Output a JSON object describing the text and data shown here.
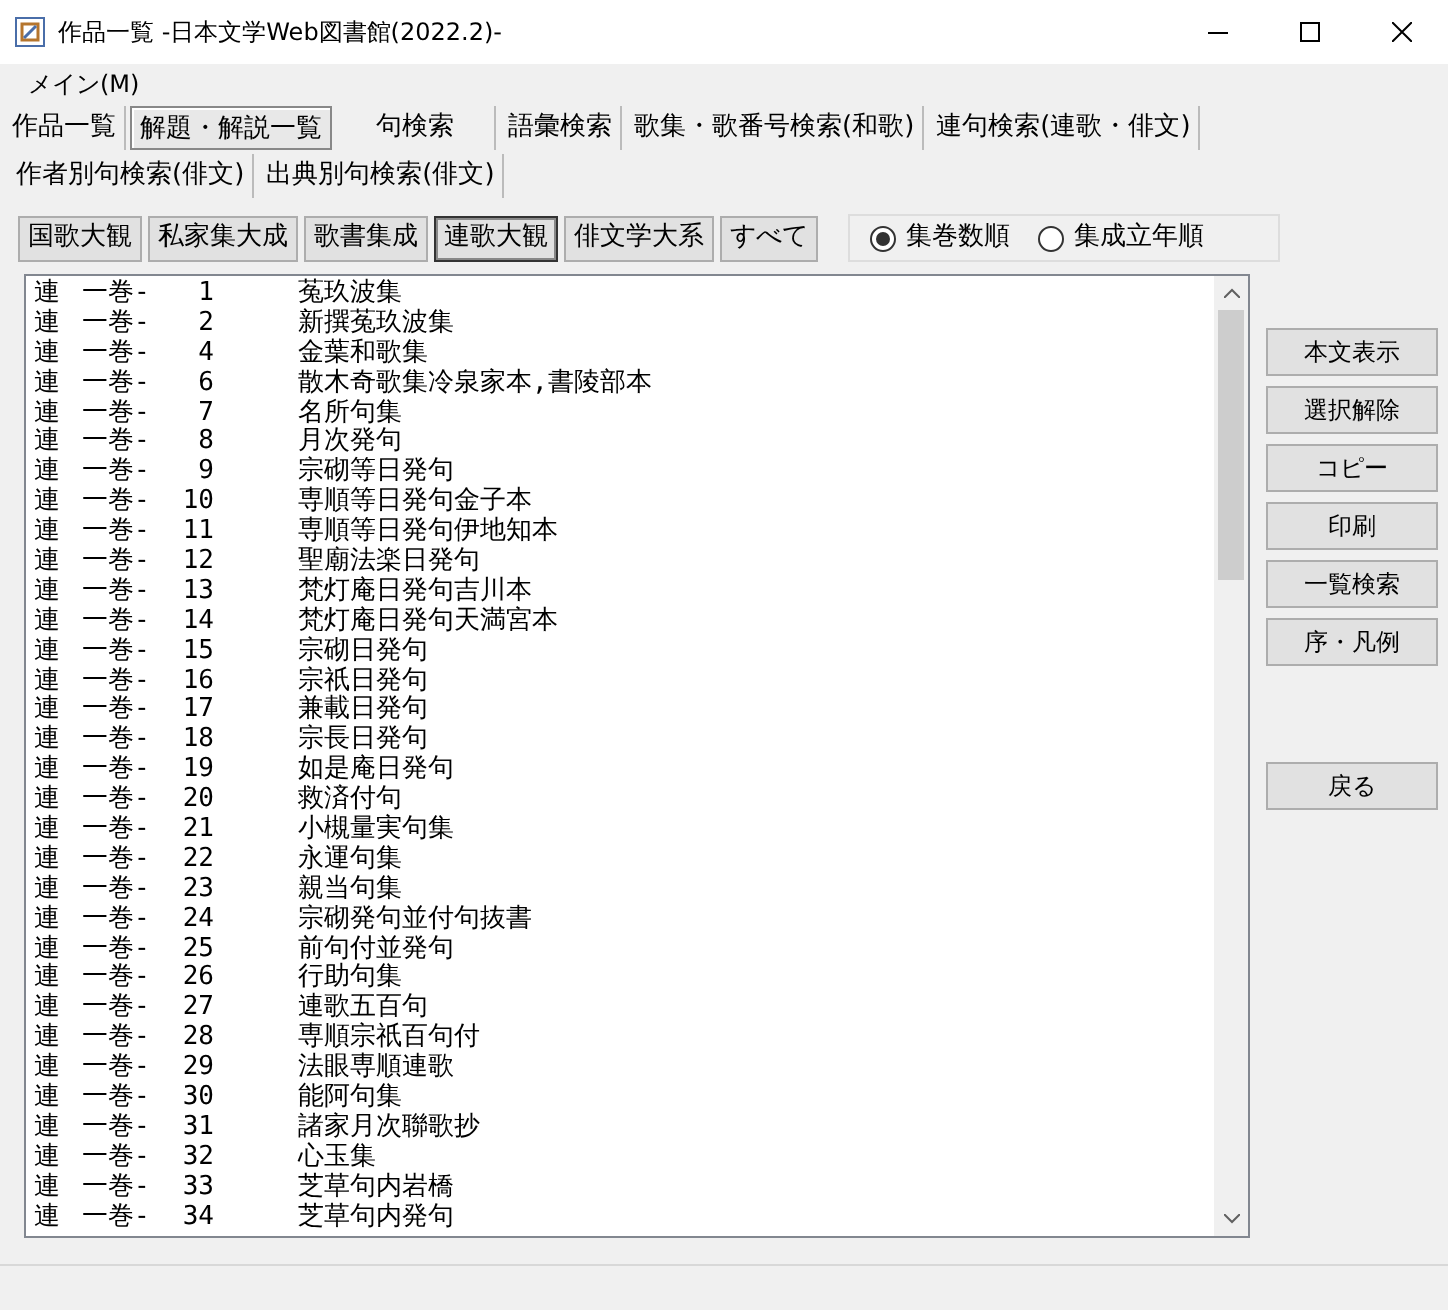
{
  "window": {
    "title": "作品一覧 -日本文学Web図書館(2022.2)-"
  },
  "menu": [
    "メイン(M)"
  ],
  "tabs": [
    {
      "label": "作品一覧",
      "selected": false
    },
    {
      "label": "解題・解説一覧",
      "selected": true
    },
    {
      "label": "句検索",
      "selected": false
    },
    {
      "label": "語彙検索",
      "selected": false
    },
    {
      "label": "歌集・歌番号検索(和歌)",
      "selected": false
    },
    {
      "label": "連句検索(連歌・俳文)",
      "selected": false
    },
    {
      "label": "作者別句検索(俳文)",
      "selected": false
    },
    {
      "label": "出典別句検索(俳文)",
      "selected": false
    }
  ],
  "collections": [
    {
      "label": "国歌大観",
      "selected": false
    },
    {
      "label": "私家集大成",
      "selected": false
    },
    {
      "label": "歌書集成",
      "selected": false
    },
    {
      "label": "連歌大観",
      "selected": true
    },
    {
      "label": "俳文学大系",
      "selected": false
    },
    {
      "label": "すべて",
      "selected": false
    }
  ],
  "sort_options": [
    {
      "label": "集巻数順",
      "selected": true
    },
    {
      "label": "集成立年順",
      "selected": false
    }
  ],
  "rows": [
    {
      "series": "連",
      "volume": "一巻-",
      "number": "1",
      "title": "菟玖波集"
    },
    {
      "series": "連",
      "volume": "一巻-",
      "number": "2",
      "title": "新撰菟玖波集"
    },
    {
      "series": "連",
      "volume": "一巻-",
      "number": "4",
      "title": "金葉和歌集"
    },
    {
      "series": "連",
      "volume": "一巻-",
      "number": "6",
      "title": "散木奇歌集冷泉家本,書陵部本"
    },
    {
      "series": "連",
      "volume": "一巻-",
      "number": "7",
      "title": "名所句集"
    },
    {
      "series": "連",
      "volume": "一巻-",
      "number": "8",
      "title": "月次発句"
    },
    {
      "series": "連",
      "volume": "一巻-",
      "number": "9",
      "title": "宗砌等日発句"
    },
    {
      "series": "連",
      "volume": "一巻-",
      "number": "10",
      "title": "専順等日発句金子本"
    },
    {
      "series": "連",
      "volume": "一巻-",
      "number": "11",
      "title": "専順等日発句伊地知本"
    },
    {
      "series": "連",
      "volume": "一巻-",
      "number": "12",
      "title": "聖廟法楽日発句"
    },
    {
      "series": "連",
      "volume": "一巻-",
      "number": "13",
      "title": "梵灯庵日発句吉川本"
    },
    {
      "series": "連",
      "volume": "一巻-",
      "number": "14",
      "title": "梵灯庵日発句天満宮本"
    },
    {
      "series": "連",
      "volume": "一巻-",
      "number": "15",
      "title": "宗砌日発句"
    },
    {
      "series": "連",
      "volume": "一巻-",
      "number": "16",
      "title": "宗祇日発句"
    },
    {
      "series": "連",
      "volume": "一巻-",
      "number": "17",
      "title": "兼載日発句"
    },
    {
      "series": "連",
      "volume": "一巻-",
      "number": "18",
      "title": "宗長日発句"
    },
    {
      "series": "連",
      "volume": "一巻-",
      "number": "19",
      "title": "如是庵日発句"
    },
    {
      "series": "連",
      "volume": "一巻-",
      "number": "20",
      "title": "救済付句"
    },
    {
      "series": "連",
      "volume": "一巻-",
      "number": "21",
      "title": "小槻量実句集"
    },
    {
      "series": "連",
      "volume": "一巻-",
      "number": "22",
      "title": "永運句集"
    },
    {
      "series": "連",
      "volume": "一巻-",
      "number": "23",
      "title": "親当句集"
    },
    {
      "series": "連",
      "volume": "一巻-",
      "number": "24",
      "title": "宗砌発句並付句抜書"
    },
    {
      "series": "連",
      "volume": "一巻-",
      "number": "25",
      "title": "前句付並発句"
    },
    {
      "series": "連",
      "volume": "一巻-",
      "number": "26",
      "title": "行助句集"
    },
    {
      "series": "連",
      "volume": "一巻-",
      "number": "27",
      "title": "連歌五百句"
    },
    {
      "series": "連",
      "volume": "一巻-",
      "number": "28",
      "title": "専順宗祇百句付"
    },
    {
      "series": "連",
      "volume": "一巻-",
      "number": "29",
      "title": "法眼専順連歌"
    },
    {
      "series": "連",
      "volume": "一巻-",
      "number": "30",
      "title": "能阿句集"
    },
    {
      "series": "連",
      "volume": "一巻-",
      "number": "31",
      "title": "諸家月次聯歌抄"
    },
    {
      "series": "連",
      "volume": "一巻-",
      "number": "32",
      "title": "心玉集"
    },
    {
      "series": "連",
      "volume": "一巻-",
      "number": "33",
      "title": "芝草句内岩橋"
    },
    {
      "series": "連",
      "volume": "一巻-",
      "number": "34",
      "title": "芝草句内発句"
    }
  ],
  "side_buttons": [
    {
      "label": "本文表示",
      "kind": "button"
    },
    {
      "label": "選択解除",
      "kind": "button"
    },
    {
      "label": "コピー",
      "kind": "button"
    },
    {
      "label": "印刷",
      "kind": "button"
    },
    {
      "label": "一覧検索",
      "kind": "button"
    },
    {
      "label": "序・凡例",
      "kind": "button"
    },
    {
      "kind": "gap"
    },
    {
      "label": "戻る",
      "kind": "button"
    }
  ]
}
